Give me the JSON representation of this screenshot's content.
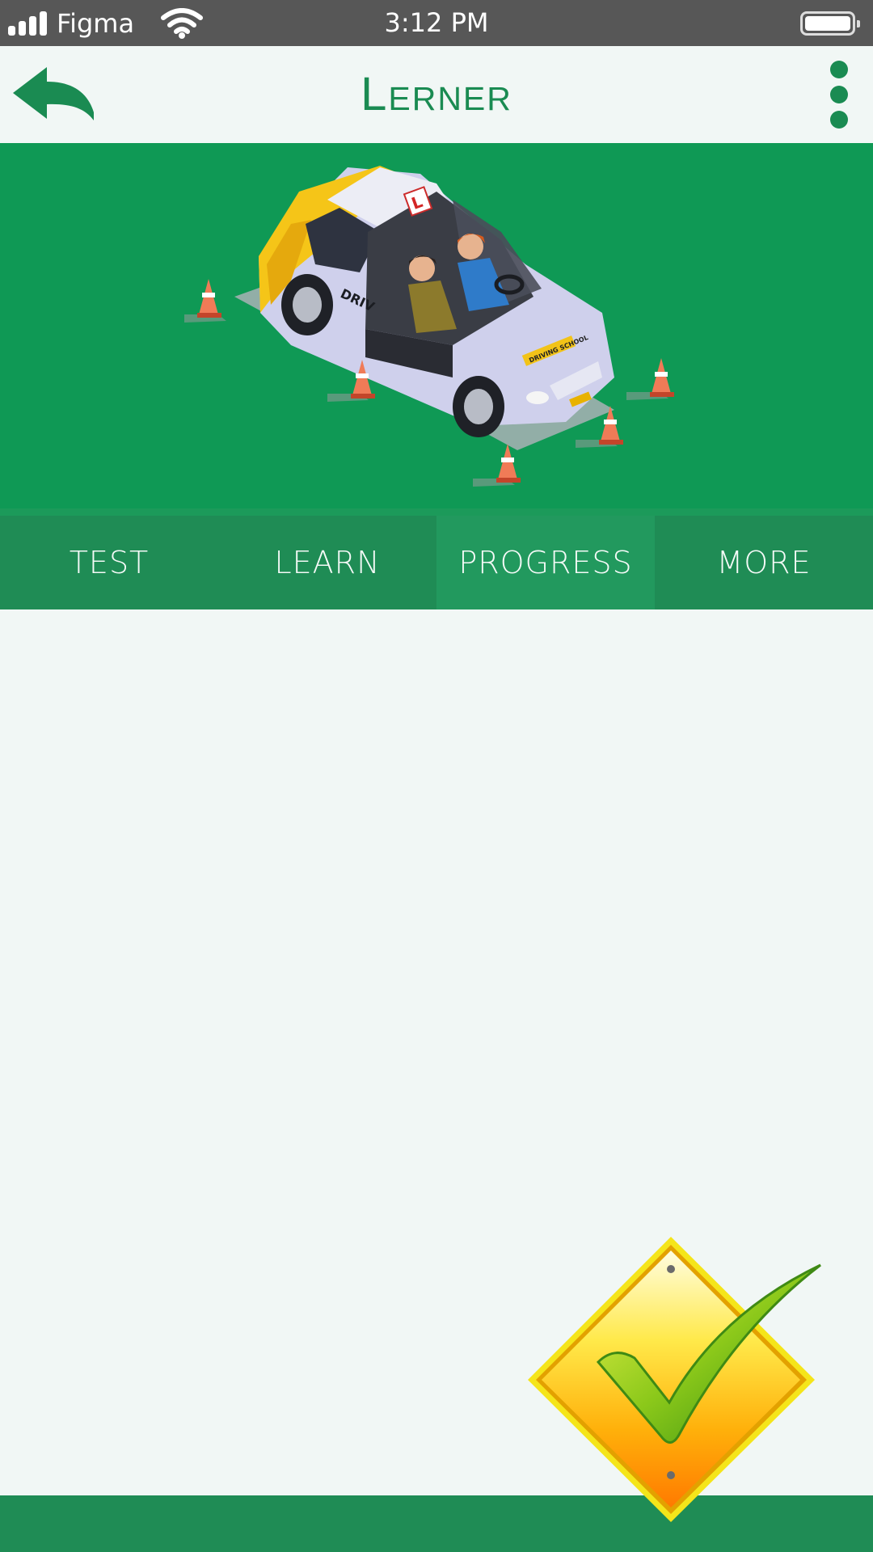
{
  "status_bar": {
    "carrier": "Figma",
    "time": "3:12 PM",
    "icons": [
      "signal-icon",
      "wifi-icon",
      "battery-icon"
    ]
  },
  "app_bar": {
    "title": "Lerner",
    "back_icon": "back-arrow-icon",
    "menu_icon": "more-vertical-icon"
  },
  "hero": {
    "image": "driving-school-car-illustration",
    "plate_letter": "L",
    "door_text": "DRIV",
    "hood_sign": "DRIVING SCHOOL"
  },
  "tabs": [
    {
      "label": "TEST",
      "active": false
    },
    {
      "label": "LEARN",
      "active": false
    },
    {
      "label": "PROGRESS",
      "active": true
    },
    {
      "label": "MORE",
      "active": false
    }
  ],
  "badge": {
    "icon": "checkmark-sign-icon"
  },
  "colors": {
    "primary": "#1A8B52",
    "hero_bg": "#0F9955",
    "tab_bg": "#1F8C55",
    "tab_active_bg": "#22995E",
    "page_bg": "#F1F7F5",
    "status_bar_bg": "#575757"
  }
}
